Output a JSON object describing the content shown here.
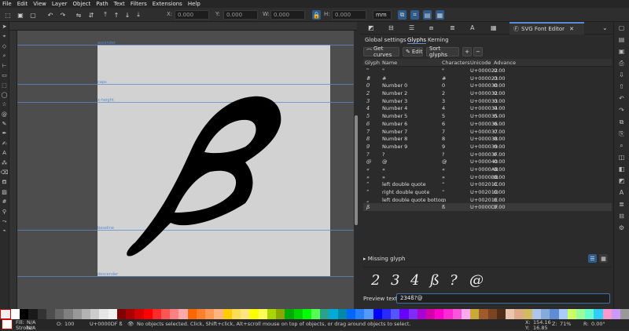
{
  "menu": [
    "File",
    "Edit",
    "View",
    "Layer",
    "Object",
    "Path",
    "Text",
    "Filters",
    "Extensions",
    "Help"
  ],
  "toolctl": {
    "x_label": "X:",
    "x_value": "0.000",
    "y_label": "Y:",
    "y_value": "0.000",
    "w_label": "W:",
    "w_value": "0.000",
    "h_label": "H:",
    "h_value": "0.000",
    "unit": "mm"
  },
  "canvas": {
    "guides": [
      {
        "label": "ascender"
      },
      {
        "label": "caps"
      },
      {
        "label": "x-height"
      },
      {
        "label": "baseline"
      },
      {
        "label": "descender"
      }
    ],
    "glyph_char": "ß"
  },
  "panel": {
    "tab_title": "SVG Font Editor",
    "subtabs": [
      "Global settings",
      "Glyphs",
      "Kerning"
    ],
    "buttons": {
      "get_curves": "Get curves",
      "edit": "Edit",
      "sort": "Sort glyphs",
      "add": "+",
      "remove": "−"
    },
    "columns": [
      "Glyph",
      "Name",
      "Characters",
      "Unicode",
      "Advance"
    ],
    "rows": [
      {
        "glyph": "\"",
        "name": "\"",
        "chars": "\"",
        "unicode": "U+000022",
        "adv": "0.00"
      },
      {
        "glyph": "#",
        "name": "#",
        "chars": "#",
        "unicode": "U+000023",
        "adv": "0.00"
      },
      {
        "glyph": "0",
        "name": "Number 0",
        "chars": "0",
        "unicode": "U+000030",
        "adv": "0.00"
      },
      {
        "glyph": "2",
        "name": "Number 2",
        "chars": "2",
        "unicode": "U+000032",
        "adv": "0.00"
      },
      {
        "glyph": "3",
        "name": "Number 3",
        "chars": "3",
        "unicode": "U+000033",
        "adv": "0.00"
      },
      {
        "glyph": "4",
        "name": "Number 4",
        "chars": "4",
        "unicode": "U+000034",
        "adv": "0.00"
      },
      {
        "glyph": "5",
        "name": "Number 5",
        "chars": "5",
        "unicode": "U+000035",
        "adv": "0.00"
      },
      {
        "glyph": "6",
        "name": "Number 6",
        "chars": "6",
        "unicode": "U+000036",
        "adv": "0.00"
      },
      {
        "glyph": "7",
        "name": "Number 7",
        "chars": "7",
        "unicode": "U+000037",
        "adv": "0.00"
      },
      {
        "glyph": "8",
        "name": "Number 8",
        "chars": "8",
        "unicode": "U+000038",
        "adv": "0.00"
      },
      {
        "glyph": "9",
        "name": "Number 9",
        "chars": "9",
        "unicode": "U+000039",
        "adv": "0.00"
      },
      {
        "glyph": "?",
        "name": "?",
        "chars": "?",
        "unicode": "U+00003F",
        "adv": "0.00"
      },
      {
        "glyph": "@",
        "name": "@",
        "chars": "@",
        "unicode": "U+000040",
        "adv": "0.00"
      },
      {
        "glyph": "«",
        "name": "«",
        "chars": "«",
        "unicode": "U+0000AB",
        "adv": "0.00"
      },
      {
        "glyph": "»",
        "name": "»",
        "chars": "»",
        "unicode": "U+0000BB",
        "adv": "0.00"
      },
      {
        "glyph": "“",
        "name": "left double quote",
        "chars": "“",
        "unicode": "U+00201C",
        "adv": "0.00"
      },
      {
        "glyph": "”",
        "name": "right double quote",
        "chars": "”",
        "unicode": "U+00201D",
        "adv": "0.00"
      },
      {
        "glyph": "„",
        "name": "left double quote bottom",
        "chars": "„",
        "unicode": "U+00201E",
        "adv": "0.00"
      },
      {
        "glyph": "ß",
        "name": "",
        "chars": "ß",
        "unicode": "U+0000DF",
        "adv": "0.00"
      }
    ],
    "missing_glyph": "Missing glyph",
    "preview_glyphs": [
      "2",
      "3",
      "4",
      "ß",
      "?",
      "@"
    ],
    "preview_label": "Preview text:",
    "preview_text": "234ß?@"
  },
  "status": {
    "fill_label": "Fill:",
    "fill_value": "N/A",
    "stroke_label": "Stroke:",
    "stroke_value": "N/A",
    "opacity_label": "O:",
    "opacity_value": "100",
    "layer": "U+0000DF ß",
    "message": "No objects selected. Click, Shift+click, Alt+scroll mouse on top of objects, or drag around objects to select.",
    "x_label": "X:",
    "x_value": "154.16",
    "y_label": "Y:",
    "y_value": "16.85",
    "zoom_label": "Z:",
    "zoom_value": "71%",
    "rot_label": "R:",
    "rot_value": "0.00°"
  },
  "palette": [
    "#ffffff",
    "#000000",
    "#1a1a1a",
    "#333",
    "#4d4d4d",
    "#666",
    "#808080",
    "#999",
    "#b3b3b3",
    "#ccc",
    "#e6e6e6",
    "#f2f2f2",
    "#800000",
    "#aa0000",
    "#d40000",
    "#ff0000",
    "#ff2a2a",
    "#ff5555",
    "#ff8080",
    "#ffaaaa",
    "#ff6600",
    "#ff7f2a",
    "#ff9955",
    "#ffb380",
    "#ffcc00",
    "#ffdd55",
    "#ffe680",
    "#ffff00",
    "#ffff55",
    "#aad400",
    "#88aa00",
    "#00aa00",
    "#00d400",
    "#00ff00",
    "#55ff55",
    "#2ca089",
    "#00aad4",
    "#0088aa",
    "#0066ff",
    "#2a7fff",
    "#5599ff",
    "#0000ff",
    "#2a2aff",
    "#5555ff",
    "#6600ff",
    "#7f2aff",
    "#aa00d4",
    "#d400aa",
    "#ff00cc",
    "#ff2ad4",
    "#ff55dd",
    "#ffaaee",
    "#c8ab37",
    "#a05a2c",
    "#784421",
    "#502d16",
    "#e9c6af",
    "#deaa87",
    "#d3bc5f",
    "#afc6e9",
    "#87aade",
    "#5f8dd3",
    "#aaccff",
    "#ccff66",
    "#99ff99",
    "#66ffcc",
    "#33ccff",
    "#ff99cc",
    "#cc99ff",
    "#999999"
  ]
}
